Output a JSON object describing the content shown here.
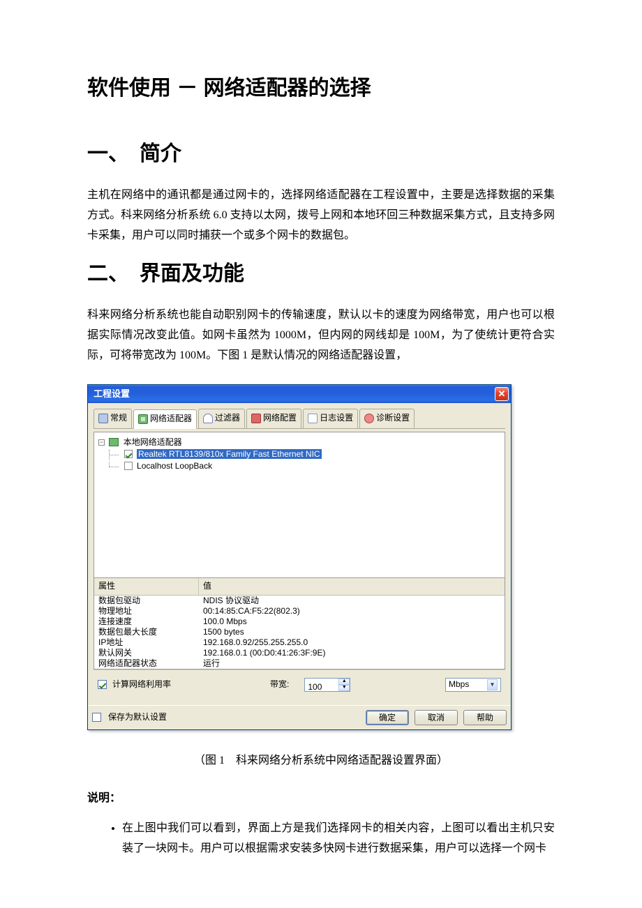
{
  "doc": {
    "title": "软件使用 － 网络适配器的选择",
    "section1_title": "一、　简介",
    "section1_p1": "主机在网络中的通讯都是通过网卡的，选择网络适配器在工程设置中，主要是选择数据的采集方式。科来网络分析系统 6.0 支持以太网，拨号上网和本地环回三种数据采集方式，且支持多网卡采集，用户可以同时捕获一个或多个网卡的数据包。",
    "section2_title": "二、　界面及功能",
    "section2_p1": "科来网络分析系统也能自动职别网卡的传输速度，默认以卡的速度为网络带宽，用户也可以根据实际情况改变此值。如网卡虽然为 1000M，但内网的网线却是 100M，为了使统计更符合实际，可将带宽改为 100M。下图 1 是默认情况的网络适配器设置，",
    "figure_caption": "（图 1　科来网络分析系统中网络适配器设置界面）",
    "shuoming": "说明：",
    "bullet1": "在上图中我们可以看到，界面上方是我们选择网卡的相关内容，上图可以看出主机只安装了一块网卡。用户可以根据需求安装多快网卡进行数据采集，用户可以选择一个网卡"
  },
  "dlg": {
    "title": "工程设置",
    "close": "✕",
    "tabs": {
      "general": "常规",
      "adapter": "网络适配器",
      "filter": "过滤器",
      "netcfg": "网络配置",
      "log": "日志设置",
      "diag": "诊断设置"
    },
    "tree": {
      "root": "本地网络适配器",
      "nic": "Realtek RTL8139/810x Family Fast Ethernet NIC",
      "loop": "Localhost LoopBack"
    },
    "prop": {
      "head_attr": "属性",
      "head_val": "值",
      "rows": [
        {
          "k": "数据包驱动",
          "v": "NDIS 协议驱动"
        },
        {
          "k": "物理地址",
          "v": "00:14:85:CA:F5:22(802.3)"
        },
        {
          "k": "连接速度",
          "v": "100.0 Mbps"
        },
        {
          "k": "数据包最大长度",
          "v": "1500 bytes"
        },
        {
          "k": "IP地址",
          "v": "192.168.0.92/255.255.255.0"
        },
        {
          "k": "默认网关",
          "v": "192.168.0.1 (00:D0:41:26:3F:9E)"
        },
        {
          "k": "网络适配器状态",
          "v": "运行"
        }
      ]
    },
    "bw": {
      "calc_label": "计算网络利用率",
      "bw_label": "带宽:",
      "value": "100",
      "unit": "Mbps"
    },
    "footer": {
      "save_default": "保存为默认设置",
      "ok": "确定",
      "cancel": "取消",
      "help": "帮助"
    }
  }
}
